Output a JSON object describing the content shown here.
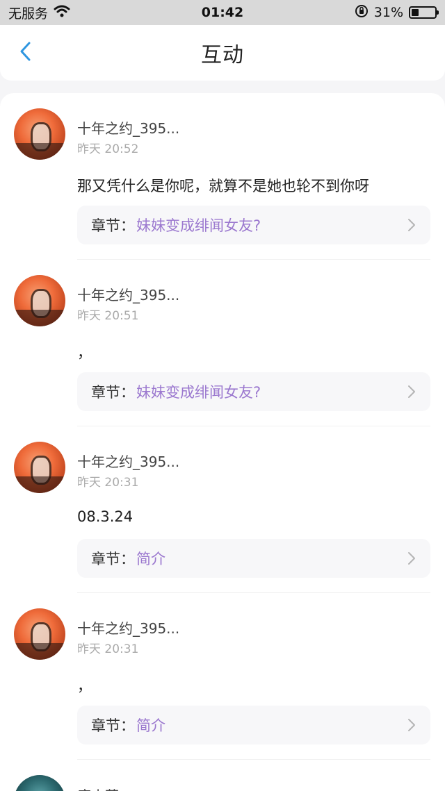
{
  "status_bar": {
    "carrier": "无服务",
    "time": "01:42",
    "battery_percent": "31%",
    "battery_level": 0.31
  },
  "nav": {
    "title": "互动"
  },
  "chapter_prefix": "章节：",
  "comments": [
    {
      "username": "十年之约_395...",
      "time": "昨天 20:52",
      "content": "那又凭什么是你呢，就算不是她也轮不到你呀",
      "chapter": "妹妹变成绯闻女友?"
    },
    {
      "username": "十年之约_395...",
      "time": "昨天 20:51",
      "content": "，",
      "chapter": "妹妹变成绯闻女友?"
    },
    {
      "username": "十年之约_395...",
      "time": "昨天 20:31",
      "content": "08.3.24",
      "chapter": "简介"
    },
    {
      "username": "十年之约_395...",
      "time": "昨天 20:31",
      "content": "，",
      "chapter": "简介"
    }
  ],
  "partial_item": {
    "username": "唐小草"
  },
  "colors": {
    "accent": "#2f96e0",
    "chapter_link": "#9b78cf"
  }
}
